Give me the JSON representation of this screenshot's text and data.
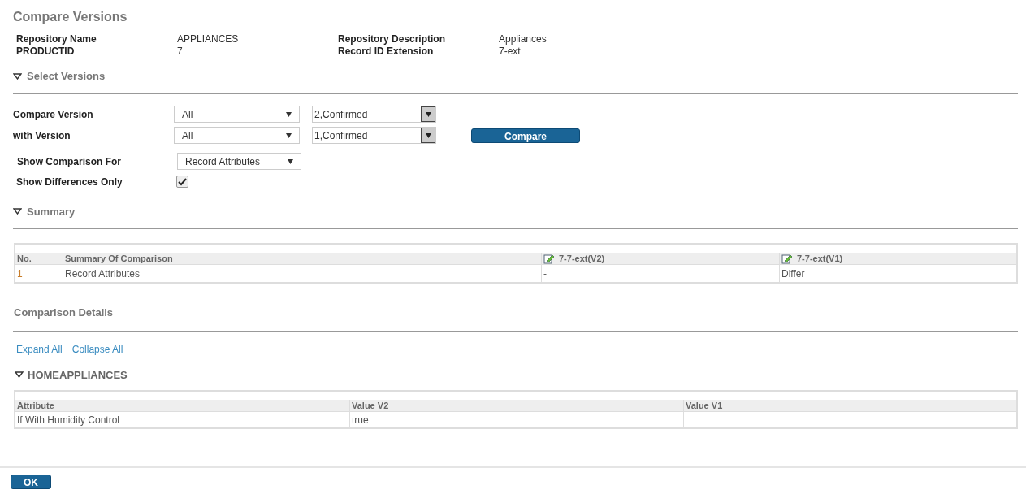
{
  "title": "Compare Versions",
  "info": [
    {
      "label": "Repository Name",
      "value": "APPLIANCES"
    },
    {
      "label": "Repository Description",
      "value": "Appliances"
    },
    {
      "label": "PRODUCTID",
      "value": "7"
    },
    {
      "label": "Record ID Extension",
      "value": "7-ext"
    }
  ],
  "select_versions": {
    "title": "Select Versions",
    "expanded": true,
    "rows": [
      {
        "label": "Compare Version",
        "filter": "All",
        "version": "2,Confirmed"
      },
      {
        "label": "with Version",
        "filter": "All",
        "version": "1,Confirmed"
      }
    ],
    "compare_button": "Compare",
    "show_comparison_for": {
      "label": "Show Comparison For",
      "value": "Record Attributes"
    },
    "differences_only": {
      "label": "Show Differences Only",
      "checked": true
    }
  },
  "summary": {
    "title": "Summary",
    "expanded": true,
    "columns": [
      "No.",
      "Summary Of Comparison",
      "7-7-ext(V2)",
      "7-7-ext(V1)"
    ],
    "rows": [
      [
        "1",
        "Record Attributes",
        "-",
        "Differ"
      ]
    ]
  },
  "details": {
    "title": "Comparison Details",
    "links": [
      "Expand All",
      "Collapse All"
    ],
    "groups": [
      {
        "name": "HOMEAPPLIANCES",
        "expanded": true,
        "columns": [
          "Attribute",
          "Value V2",
          "Value V1"
        ],
        "rows": [
          [
            "If With Humidity Control",
            "true",
            ""
          ]
        ]
      }
    ]
  },
  "ok_button": "OK"
}
